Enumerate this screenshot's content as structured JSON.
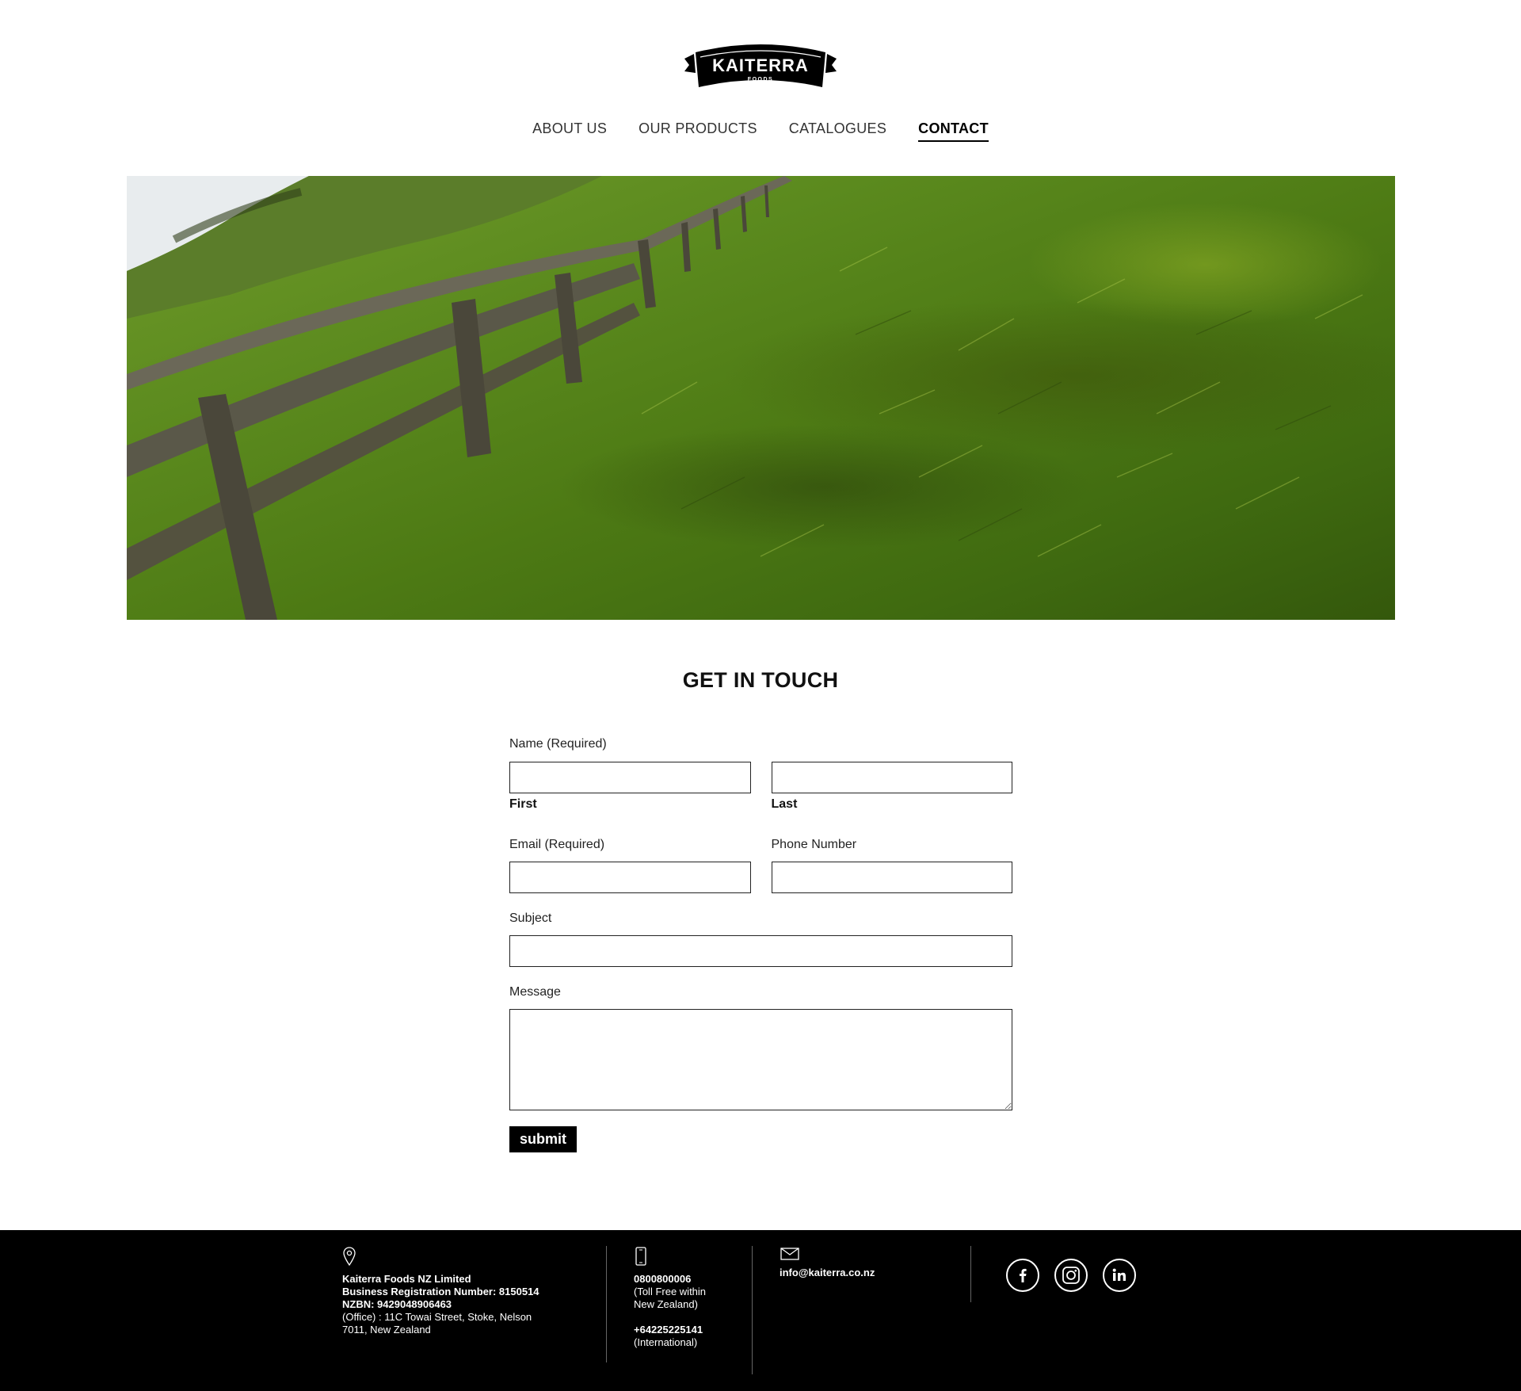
{
  "brand": {
    "logo_text": "KAITERRA",
    "logo_subtext": "FOODS"
  },
  "nav": {
    "items": [
      {
        "label": "ABOUT US",
        "active": false
      },
      {
        "label": "OUR PRODUCTS",
        "active": false
      },
      {
        "label": "CATALOGUES",
        "active": false
      },
      {
        "label": "CONTACT",
        "active": true
      }
    ]
  },
  "hero": {
    "icon": "landscape-image"
  },
  "contact": {
    "title": "GET IN TOUCH",
    "name_label": "Name (Required)",
    "first_label": "First",
    "last_label": "Last",
    "email_label": "Email (Required)",
    "phone_label": "Phone Number",
    "subject_label": "Subject",
    "message_label": "Message",
    "submit_label": "submit",
    "first_value": "",
    "last_value": "",
    "email_value": "",
    "phone_value": "",
    "subject_value": "",
    "message_value": ""
  },
  "footer": {
    "address": {
      "company": "Kaiterra Foods NZ Limited",
      "registration": "Business Registration Number: 8150514",
      "nzbn": "NZBN: 9429048906463",
      "office_line1": "(Office) : 11C Towai Street, Stoke, Nelson",
      "office_line2": "7011, New Zealand"
    },
    "phone": {
      "tollfree": "0800800006",
      "tollfree_note1": "(Toll Free within",
      "tollfree_note2": "New Zealand)",
      "intl": "+64225225141",
      "intl_note": "(International)"
    },
    "email": {
      "address": "info@kaiterra.co.nz"
    },
    "social": [
      {
        "icon": "facebook-icon"
      },
      {
        "icon": "instagram-icon"
      },
      {
        "icon": "linkedin-icon"
      }
    ]
  }
}
